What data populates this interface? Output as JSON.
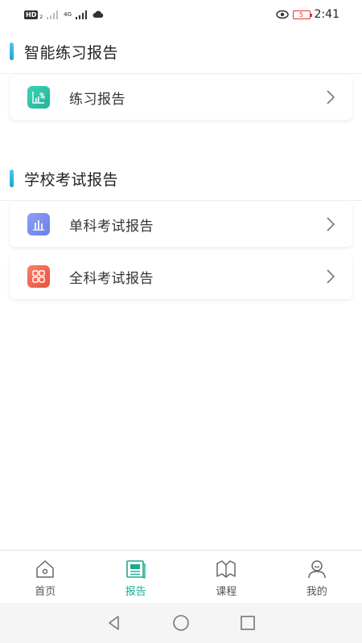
{
  "status_bar": {
    "hd_label": "HD",
    "hd_sub": "2",
    "net_top": "4G",
    "battery_level": "5",
    "time": "2:41"
  },
  "sections": [
    {
      "title": "智能练习报告",
      "items": [
        {
          "label": "练习报告",
          "icon": "chart-percent-icon",
          "color": "#2ec4a7"
        }
      ]
    },
    {
      "title": "学校考试报告",
      "items": [
        {
          "label": "单科考试报告",
          "icon": "bar-chart-icon",
          "color": "#7b8ef0"
        },
        {
          "label": "全科考试报告",
          "icon": "grid-icon",
          "color": "#f06450"
        }
      ]
    }
  ],
  "bottom_nav": [
    {
      "label": "首页",
      "icon": "home-icon",
      "active": false
    },
    {
      "label": "报告",
      "icon": "report-icon",
      "active": true
    },
    {
      "label": "课程",
      "icon": "book-icon",
      "active": false
    },
    {
      "label": "我的",
      "icon": "user-icon",
      "active": false
    }
  ],
  "colors": {
    "accent": "#1aaa8f",
    "section_bar": "#29b6e0"
  }
}
